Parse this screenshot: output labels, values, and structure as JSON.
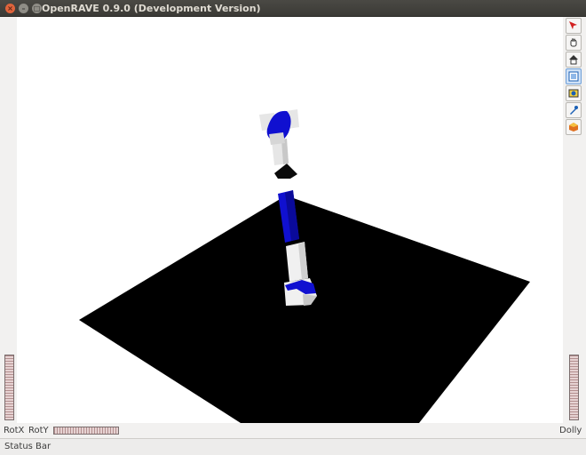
{
  "window": {
    "title": "OpenRAVE 0.9.0 (Development Version)",
    "close_glyph": "×",
    "minimize_glyph": "–",
    "maximize_glyph": "□"
  },
  "toolbar": {
    "tools": [
      {
        "name": "select-icon"
      },
      {
        "name": "hand-interact-icon"
      },
      {
        "name": "home-view-icon"
      },
      {
        "name": "view-all-icon"
      },
      {
        "name": "seek-icon"
      },
      {
        "name": "perspective-icon"
      },
      {
        "name": "render-mode-icon"
      }
    ]
  },
  "wheels": {
    "rotx_label": "RotX",
    "roty_label": "RotY",
    "dolly_label": "Dolly"
  },
  "status": {
    "text": "Status Bar"
  },
  "colors": {
    "arm_blue": "#1010d0",
    "arm_light": "#e6e6e6",
    "floor": "#000000"
  }
}
